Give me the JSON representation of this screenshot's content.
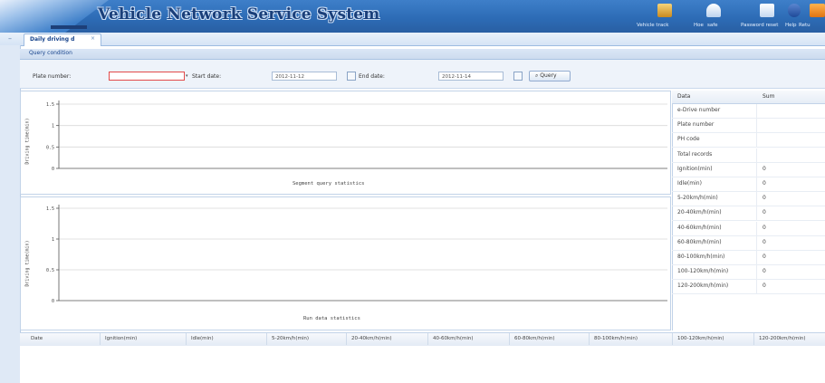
{
  "header": {
    "title": "Vehicle Network Service System",
    "actions": [
      {
        "label": "Vehicle track",
        "icon": "vehicle-track-icon",
        "color": "#d9a53a"
      },
      {
        "label": "Hoe",
        "icon": "home-icon",
        "color": "#e5eef9"
      },
      {
        "label": "safe",
        "icon": "safe-icon",
        "color": "#e5eef9"
      },
      {
        "label": "Password reset",
        "icon": "password-reset-icon",
        "color": "#e5eef9"
      },
      {
        "label": "Help",
        "icon": "help-icon",
        "color": "#2b59a8"
      },
      {
        "label": "Retu",
        "icon": "return-icon",
        "color": "#f08a1c"
      }
    ]
  },
  "tabs": [
    {
      "label": "Daily driving d"
    }
  ],
  "query": {
    "heading": "Query condition",
    "plate_label": "Plate number:",
    "plate_value": "",
    "start_label": "Start date:",
    "start_value": "2012-11-12",
    "end_label": "End date:",
    "end_value": "2012-11-14",
    "query_button": "Query"
  },
  "charts": [
    {
      "title": "Segment query statistics",
      "ylabel": "Driving time(min)",
      "ticks": [
        "1.5",
        "1",
        "0.5",
        "0"
      ]
    },
    {
      "title": "Run data statistics",
      "ylabel": "Driving time(min)",
      "ticks": [
        "1.5",
        "1",
        "0.5",
        "0"
      ]
    }
  ],
  "chart_data": [
    {
      "type": "line",
      "title": "Segment query statistics",
      "xlabel": "",
      "ylabel": "Driving time(min)",
      "ylim": [
        0,
        1.5
      ],
      "yticks": [
        0,
        0.5,
        1,
        1.5
      ],
      "series": [],
      "grid": true
    },
    {
      "type": "line",
      "title": "Run data statistics",
      "xlabel": "",
      "ylabel": "Driving time(min)",
      "ylim": [
        0,
        1.5
      ],
      "yticks": [
        0,
        0.5,
        1,
        1.5
      ],
      "series": [],
      "grid": true
    }
  ],
  "summary": {
    "headers": [
      "Data",
      "Sum"
    ],
    "rows": [
      {
        "key": "e-Drive number",
        "value": ""
      },
      {
        "key": "Plate number",
        "value": ""
      },
      {
        "key": "PH code",
        "value": ""
      },
      {
        "key": "Total records",
        "value": ""
      },
      {
        "key": "Ignition(min)",
        "value": "0"
      },
      {
        "key": "Idle(min)",
        "value": "0"
      },
      {
        "key": "5-20km/h(min)",
        "value": "0"
      },
      {
        "key": "20-40km/h(min)",
        "value": "0"
      },
      {
        "key": "40-60km/h(min)",
        "value": "0"
      },
      {
        "key": "60-80km/h(min)",
        "value": "0"
      },
      {
        "key": "80-100km/h(min)",
        "value": "0"
      },
      {
        "key": "100-120km/h(min)",
        "value": "0"
      },
      {
        "key": "120-200km/h(min)",
        "value": "0"
      }
    ]
  },
  "detail_columns": [
    "Date",
    "Ignition(min)",
    "Idle(min)",
    "5-20km/h(min)",
    "20-40km/h(min)",
    "40-60km/h(min)",
    "60-80km/h(min)",
    "80-100km/h(min)",
    "100-120km/h(min)",
    "120-200km/h(min)"
  ]
}
